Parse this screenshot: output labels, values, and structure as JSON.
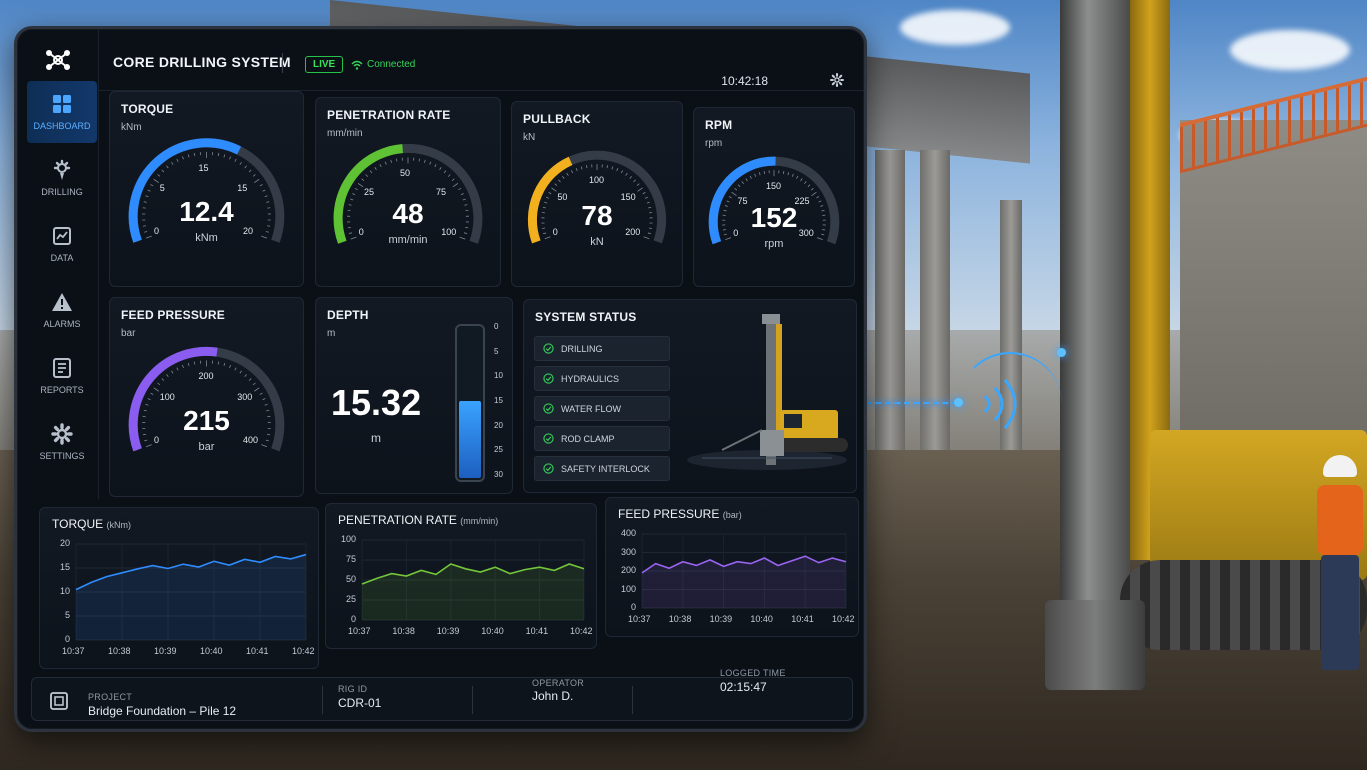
{
  "app": {
    "title": "CORE DRILLING SYSTEM",
    "live_badge": "LIVE",
    "connection": "Connected",
    "time": "10:42:18"
  },
  "sidebar": {
    "items": [
      {
        "label": "DASHBOARD",
        "icon": "dashboard-grid-icon",
        "active": true
      },
      {
        "label": "DRILLING",
        "icon": "drill-bit-icon",
        "active": false
      },
      {
        "label": "DATA",
        "icon": "data-chart-icon",
        "active": false
      },
      {
        "label": "ALARMS",
        "icon": "warning-icon",
        "active": false
      },
      {
        "label": "REPORTS",
        "icon": "report-icon",
        "active": false
      },
      {
        "label": "SETTINGS",
        "icon": "gear-icon",
        "active": false
      }
    ]
  },
  "gauges": [
    {
      "id": "torque",
      "title": "TORQUE",
      "unit": "kNm",
      "value": "12.4",
      "value_num": 12.4,
      "min": 0,
      "max": 20,
      "ticks": [
        "0",
        "5",
        "15",
        "15",
        "20"
      ],
      "color": "#2f8cff"
    },
    {
      "id": "penetration",
      "title": "PENETRATION RATE",
      "unit": "mm/min",
      "value": "48",
      "value_num": 48,
      "min": 0,
      "max": 100,
      "ticks": [
        "0",
        "25",
        "50",
        "75",
        "100"
      ],
      "color": "#5fc234"
    },
    {
      "id": "pullback",
      "title": "PULLBACK",
      "unit": "kN",
      "value": "78",
      "value_num": 78,
      "min": 0,
      "max": 200,
      "ticks": [
        "0",
        "50",
        "100",
        "150",
        "200"
      ],
      "color": "#f2b01e"
    },
    {
      "id": "rpm",
      "title": "RPM",
      "unit": "rpm",
      "value": "152",
      "value_num": 152,
      "min": 0,
      "max": 300,
      "ticks": [
        "0",
        "75",
        "150",
        "225",
        "300"
      ],
      "color": "#2f8cff"
    },
    {
      "id": "feed",
      "title": "FEED PRESSURE",
      "unit": "bar",
      "value": "215",
      "value_num": 215,
      "min": 0,
      "max": 400,
      "ticks": [
        "0",
        "100",
        "200",
        "300",
        "400"
      ],
      "color": "#8b5cf0"
    }
  ],
  "depth": {
    "title": "DEPTH",
    "unit": "m",
    "value": "15.32",
    "value_num": 15.32,
    "max": 30,
    "ticks": [
      "0",
      "5",
      "10",
      "15",
      "20",
      "25",
      "30"
    ]
  },
  "system_status": {
    "title": "SYSTEM STATUS",
    "items": [
      "DRILLING",
      "HYDRAULICS",
      "WATER FLOW",
      "ROD CLAMP",
      "SAFETY INTERLOCK"
    ],
    "ok_color": "#35c759"
  },
  "trend_charts": [
    {
      "title": "TORQUE",
      "unit": "(kNm)",
      "color": "#2f8cff",
      "y_ticks": [
        "20",
        "15",
        "10",
        "5",
        "0"
      ],
      "ylim": [
        0,
        20
      ],
      "x_ticks": [
        "10:37",
        "10:38",
        "10:39",
        "10:40",
        "10:41",
        "10:42"
      ]
    },
    {
      "title": "PENETRATION RATE",
      "unit": "(mm/min)",
      "color": "#74c63a",
      "y_ticks": [
        "100",
        "75",
        "50",
        "25",
        "0"
      ],
      "ylim": [
        0,
        100
      ],
      "x_ticks": [
        "10:37",
        "10:38",
        "10:39",
        "10:40",
        "10:41",
        "10:42"
      ]
    },
    {
      "title": "FEED PRESSURE",
      "unit": "(bar)",
      "color": "#9a64f2",
      "y_ticks": [
        "400",
        "300",
        "200",
        "100",
        "0"
      ],
      "ylim": [
        0,
        400
      ],
      "x_ticks": [
        "10:37",
        "10:38",
        "10:39",
        "10:40",
        "10:41",
        "10:42"
      ]
    }
  ],
  "chart_data": [
    {
      "type": "line",
      "title": "TORQUE",
      "ylabel": "(kNm)",
      "ylim": [
        0,
        20
      ],
      "x": [
        "10:37",
        "10:38",
        "10:39",
        "10:40",
        "10:41",
        "10:42"
      ],
      "series": [
        {
          "values": [
            10.5,
            12.0,
            13.2,
            14.0,
            14.8,
            15.5,
            14.9,
            15.8,
            15.2,
            16.4,
            15.6,
            16.8,
            16.2,
            17.4,
            16.9,
            17.8
          ]
        }
      ]
    },
    {
      "type": "line",
      "title": "PENETRATION RATE",
      "ylabel": "(mm/min)",
      "ylim": [
        0,
        100
      ],
      "x": [
        "10:37",
        "10:38",
        "10:39",
        "10:40",
        "10:41",
        "10:42"
      ],
      "series": [
        {
          "values": [
            45,
            52,
            58,
            55,
            62,
            57,
            70,
            64,
            60,
            66,
            58,
            63,
            66,
            62,
            70,
            64
          ]
        }
      ]
    },
    {
      "type": "line",
      "title": "FEED PRESSURE",
      "ylabel": "(bar)",
      "ylim": [
        0,
        400
      ],
      "x": [
        "10:37",
        "10:38",
        "10:39",
        "10:40",
        "10:41",
        "10:42"
      ],
      "series": [
        {
          "values": [
            190,
            240,
            215,
            250,
            230,
            260,
            225,
            250,
            240,
            270,
            230,
            255,
            280,
            245,
            270,
            250
          ]
        }
      ]
    }
  ],
  "footer": {
    "project_label": "PROJECT",
    "project_value": "Bridge Foundation – Pile 12",
    "rig_label": "RIG ID",
    "rig_value": "CDR-01",
    "operator_label": "OPERATOR",
    "operator_value": "John D.",
    "logged_label": "LOGGED TIME",
    "logged_value": "02:15:47"
  }
}
